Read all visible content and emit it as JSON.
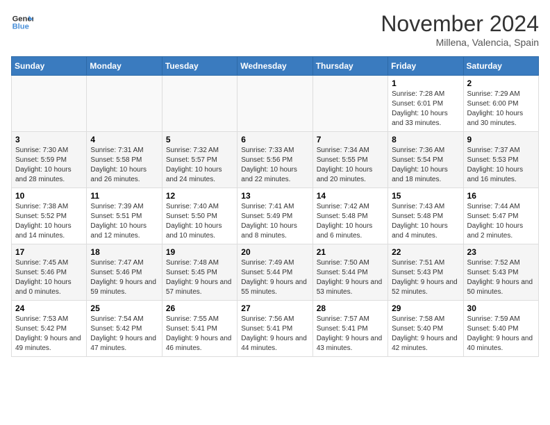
{
  "header": {
    "logo_line1": "General",
    "logo_line2": "Blue",
    "month": "November 2024",
    "location": "Millena, Valencia, Spain"
  },
  "weekdays": [
    "Sunday",
    "Monday",
    "Tuesday",
    "Wednesday",
    "Thursday",
    "Friday",
    "Saturday"
  ],
  "weeks": [
    [
      {
        "day": "",
        "info": ""
      },
      {
        "day": "",
        "info": ""
      },
      {
        "day": "",
        "info": ""
      },
      {
        "day": "",
        "info": ""
      },
      {
        "day": "",
        "info": ""
      },
      {
        "day": "1",
        "info": "Sunrise: 7:28 AM\nSunset: 6:01 PM\nDaylight: 10 hours and 33 minutes."
      },
      {
        "day": "2",
        "info": "Sunrise: 7:29 AM\nSunset: 6:00 PM\nDaylight: 10 hours and 30 minutes."
      }
    ],
    [
      {
        "day": "3",
        "info": "Sunrise: 7:30 AM\nSunset: 5:59 PM\nDaylight: 10 hours and 28 minutes."
      },
      {
        "day": "4",
        "info": "Sunrise: 7:31 AM\nSunset: 5:58 PM\nDaylight: 10 hours and 26 minutes."
      },
      {
        "day": "5",
        "info": "Sunrise: 7:32 AM\nSunset: 5:57 PM\nDaylight: 10 hours and 24 minutes."
      },
      {
        "day": "6",
        "info": "Sunrise: 7:33 AM\nSunset: 5:56 PM\nDaylight: 10 hours and 22 minutes."
      },
      {
        "day": "7",
        "info": "Sunrise: 7:34 AM\nSunset: 5:55 PM\nDaylight: 10 hours and 20 minutes."
      },
      {
        "day": "8",
        "info": "Sunrise: 7:36 AM\nSunset: 5:54 PM\nDaylight: 10 hours and 18 minutes."
      },
      {
        "day": "9",
        "info": "Sunrise: 7:37 AM\nSunset: 5:53 PM\nDaylight: 10 hours and 16 minutes."
      }
    ],
    [
      {
        "day": "10",
        "info": "Sunrise: 7:38 AM\nSunset: 5:52 PM\nDaylight: 10 hours and 14 minutes."
      },
      {
        "day": "11",
        "info": "Sunrise: 7:39 AM\nSunset: 5:51 PM\nDaylight: 10 hours and 12 minutes."
      },
      {
        "day": "12",
        "info": "Sunrise: 7:40 AM\nSunset: 5:50 PM\nDaylight: 10 hours and 10 minutes."
      },
      {
        "day": "13",
        "info": "Sunrise: 7:41 AM\nSunset: 5:49 PM\nDaylight: 10 hours and 8 minutes."
      },
      {
        "day": "14",
        "info": "Sunrise: 7:42 AM\nSunset: 5:48 PM\nDaylight: 10 hours and 6 minutes."
      },
      {
        "day": "15",
        "info": "Sunrise: 7:43 AM\nSunset: 5:48 PM\nDaylight: 10 hours and 4 minutes."
      },
      {
        "day": "16",
        "info": "Sunrise: 7:44 AM\nSunset: 5:47 PM\nDaylight: 10 hours and 2 minutes."
      }
    ],
    [
      {
        "day": "17",
        "info": "Sunrise: 7:45 AM\nSunset: 5:46 PM\nDaylight: 10 hours and 0 minutes."
      },
      {
        "day": "18",
        "info": "Sunrise: 7:47 AM\nSunset: 5:46 PM\nDaylight: 9 hours and 59 minutes."
      },
      {
        "day": "19",
        "info": "Sunrise: 7:48 AM\nSunset: 5:45 PM\nDaylight: 9 hours and 57 minutes."
      },
      {
        "day": "20",
        "info": "Sunrise: 7:49 AM\nSunset: 5:44 PM\nDaylight: 9 hours and 55 minutes."
      },
      {
        "day": "21",
        "info": "Sunrise: 7:50 AM\nSunset: 5:44 PM\nDaylight: 9 hours and 53 minutes."
      },
      {
        "day": "22",
        "info": "Sunrise: 7:51 AM\nSunset: 5:43 PM\nDaylight: 9 hours and 52 minutes."
      },
      {
        "day": "23",
        "info": "Sunrise: 7:52 AM\nSunset: 5:43 PM\nDaylight: 9 hours and 50 minutes."
      }
    ],
    [
      {
        "day": "24",
        "info": "Sunrise: 7:53 AM\nSunset: 5:42 PM\nDaylight: 9 hours and 49 minutes."
      },
      {
        "day": "25",
        "info": "Sunrise: 7:54 AM\nSunset: 5:42 PM\nDaylight: 9 hours and 47 minutes."
      },
      {
        "day": "26",
        "info": "Sunrise: 7:55 AM\nSunset: 5:41 PM\nDaylight: 9 hours and 46 minutes."
      },
      {
        "day": "27",
        "info": "Sunrise: 7:56 AM\nSunset: 5:41 PM\nDaylight: 9 hours and 44 minutes."
      },
      {
        "day": "28",
        "info": "Sunrise: 7:57 AM\nSunset: 5:41 PM\nDaylight: 9 hours and 43 minutes."
      },
      {
        "day": "29",
        "info": "Sunrise: 7:58 AM\nSunset: 5:40 PM\nDaylight: 9 hours and 42 minutes."
      },
      {
        "day": "30",
        "info": "Sunrise: 7:59 AM\nSunset: 5:40 PM\nDaylight: 9 hours and 40 minutes."
      }
    ]
  ]
}
